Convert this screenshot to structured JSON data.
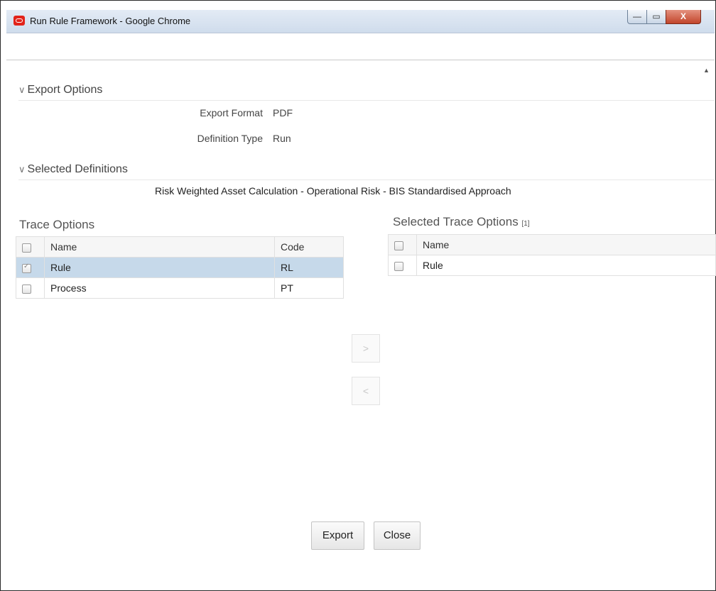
{
  "window": {
    "title": "Run Rule Framework - Google Chrome",
    "controls": {
      "minimize": "—",
      "maximize": "▭",
      "close": "X"
    }
  },
  "export_options": {
    "header": "Export Options",
    "fields": [
      {
        "label": "Export Format",
        "value": "PDF"
      },
      {
        "label": "Definition Type",
        "value": "Run"
      }
    ]
  },
  "selected_definitions": {
    "header": "Selected Definitions",
    "items": [
      "Risk Weighted Asset Calculation - Operational Risk - BIS Standardised Approach"
    ]
  },
  "trace_options": {
    "title": "Trace Options",
    "columns": [
      "Name",
      "Code"
    ],
    "rows": [
      {
        "name": "Rule",
        "code": "RL",
        "checked": true,
        "selected": true
      },
      {
        "name": "Process",
        "code": "PT",
        "checked": false,
        "selected": false
      }
    ]
  },
  "selected_trace_options": {
    "title": "Selected Trace Options",
    "count": "[1]",
    "columns": [
      "Name"
    ],
    "rows": [
      {
        "name": "Rule",
        "checked": false
      }
    ]
  },
  "move_buttons": {
    "add": ">",
    "remove": "<"
  },
  "actions": {
    "export_label": "Export",
    "close_label": "Close"
  },
  "colors": {
    "selected_row": "#c6d9ea",
    "close_button": "#c2452b"
  }
}
